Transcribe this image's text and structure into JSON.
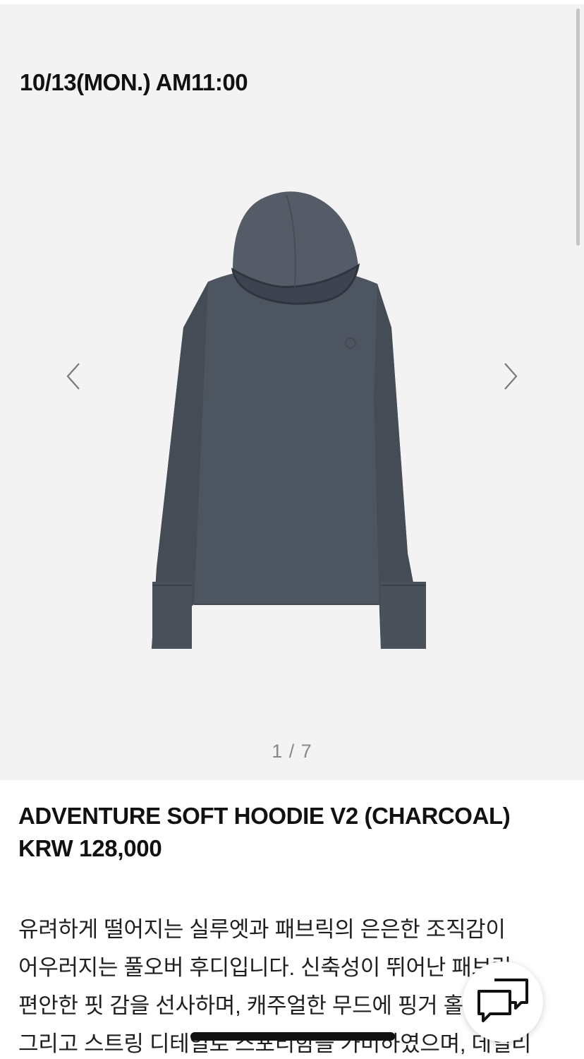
{
  "release": {
    "date_text": "10/13(MON.) AM11:00"
  },
  "gallery": {
    "current": 1,
    "total": 7,
    "pager_text": "1 / 7",
    "image_alt": "hoodie-photo",
    "garment_color": "#4d5560"
  },
  "product": {
    "name": "ADVENTURE SOFT HOODIE V2 (CHARCOAL)",
    "price": "KRW 128,000"
  },
  "description": {
    "lines": [
      "유려하게 떨어지는 실루엣과 패브릭의 은은한 조직감이",
      "어우러지는 풀오버 후디입니다. 신축성이 뛰어난 패브릭",
      "편안한 핏 감을 선사하며, 캐주얼한 무드에 핑거 홀 드,",
      "그리고 스트링 디테일로 스포티함을 가미하였으며, 데일리"
    ]
  },
  "icons": {
    "prev": "chevron-left-icon",
    "next": "chevron-right-icon",
    "chat": "chat-bubbles-icon"
  }
}
